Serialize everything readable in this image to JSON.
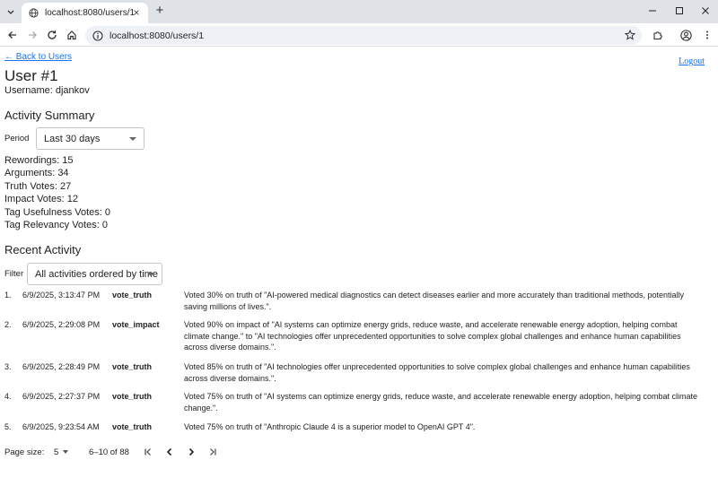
{
  "browser": {
    "tab_title": "localhost:8080/users/1",
    "address": "localhost:8080/users/1"
  },
  "page": {
    "back_link": "← Back to Users",
    "logout_link": "Logout",
    "title": "User #1",
    "username_label": "Username:",
    "username_value": "djankov",
    "summary": {
      "heading": "Activity Summary",
      "period_label": "Period",
      "period_value": "Last 30 days",
      "stats": [
        {
          "label": "Rewordings:",
          "value": "15"
        },
        {
          "label": "Arguments:",
          "value": "34"
        },
        {
          "label": "Truth Votes:",
          "value": "27"
        },
        {
          "label": "Impact Votes:",
          "value": "12"
        },
        {
          "label": "Tag Usefulness Votes:",
          "value": "0"
        },
        {
          "label": "Tag Relevancy Votes:",
          "value": "0"
        }
      ]
    },
    "recent": {
      "heading": "Recent Activity",
      "filter_label": "Filter",
      "filter_value": "All activities ordered by time",
      "rows": [
        {
          "num": "1.",
          "timestamp": "6/9/2025, 3:13:47 PM",
          "type": "vote_truth",
          "description": "Voted 30% on truth of \"AI-powered medical diagnostics can detect diseases earlier and more accurately than traditional methods, potentially saving millions of lives.\"."
        },
        {
          "num": "2.",
          "timestamp": "6/9/2025, 2:29:08 PM",
          "type": "vote_impact",
          "description": "Voted 90% on impact of \"AI systems can optimize energy grids, reduce waste, and accelerate renewable energy adoption, helping combat climate change.\" to \"AI technologies offer unprecedented opportunities to solve complex global challenges and enhance human capabilities across diverse domains.\"."
        },
        {
          "num": "3.",
          "timestamp": "6/9/2025, 2:28:49 PM",
          "type": "vote_truth",
          "description": "Voted 85% on truth of \"AI technologies offer unprecedented opportunities to solve complex global challenges and enhance human capabilities across diverse domains.\"."
        },
        {
          "num": "4.",
          "timestamp": "6/9/2025, 2:27:37 PM",
          "type": "vote_truth",
          "description": "Voted 75% on truth of \"AI systems can optimize energy grids, reduce waste, and accelerate renewable energy adoption, helping combat climate change.\"."
        },
        {
          "num": "5.",
          "timestamp": "6/9/2025, 9:23:54 AM",
          "type": "vote_truth",
          "description": "Voted 75% on truth of \"Anthropic Claude 4 is a superior model to OpenAI GPT 4\"."
        }
      ]
    },
    "pagination": {
      "page_size_label": "Page size:",
      "page_size_value": "5",
      "range": "6–10 of 88"
    }
  }
}
